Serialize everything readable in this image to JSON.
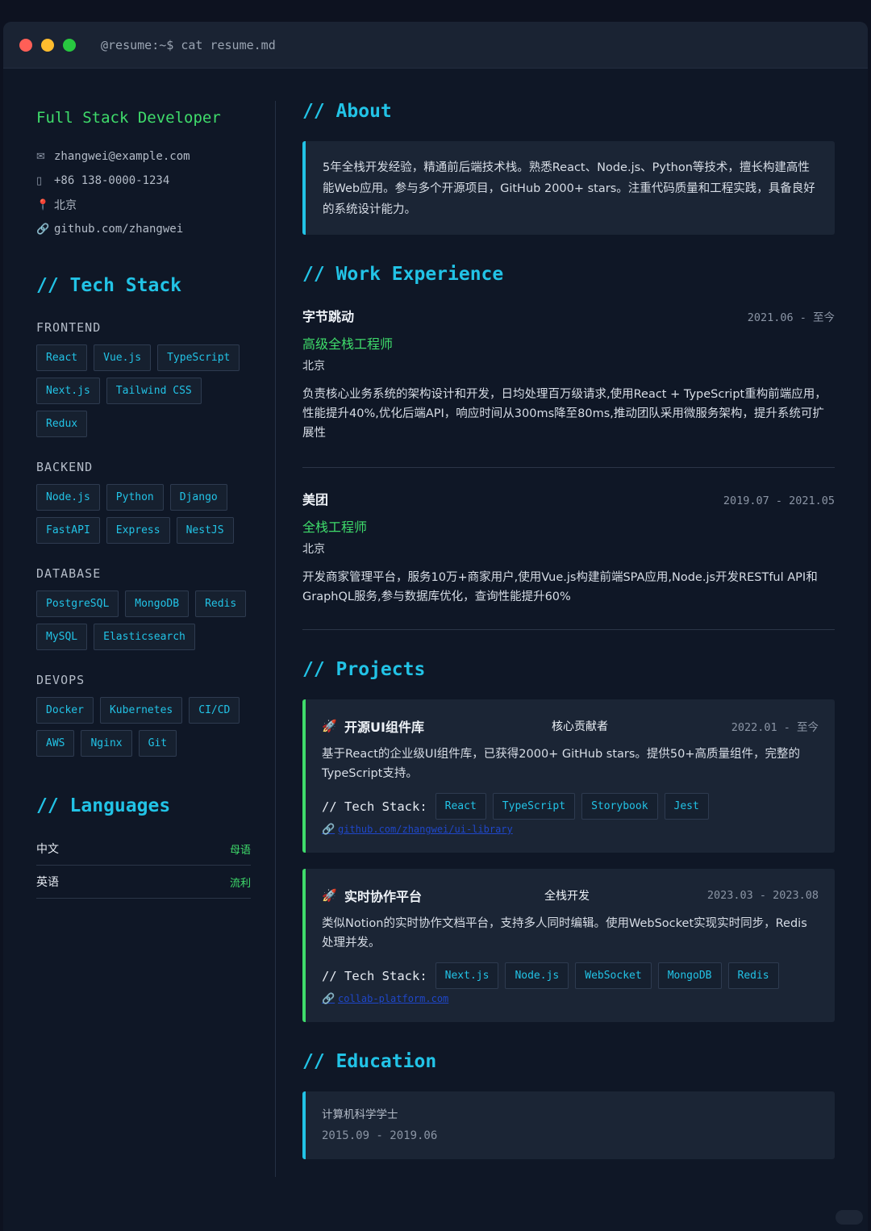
{
  "window": {
    "prompt": "@resume:~$ cat resume.md"
  },
  "sidebar": {
    "role": "Full Stack Developer",
    "contact": [
      {
        "icon": "email-icon",
        "glyph": "✉",
        "text": "zhangwei@example.com"
      },
      {
        "icon": "phone-icon",
        "glyph": "▯",
        "text": "+86 138-0000-1234"
      },
      {
        "icon": "location-pin-icon",
        "glyph": "📍",
        "text": "北京"
      },
      {
        "icon": "link-icon",
        "glyph": "🔗",
        "text": "github.com/zhangwei"
      }
    ],
    "tech_title": "// Tech Stack",
    "categories": [
      {
        "name": "FRONTEND",
        "tags": [
          "React",
          "Vue.js",
          "TypeScript",
          "Next.js",
          "Tailwind CSS",
          "Redux"
        ]
      },
      {
        "name": "BACKEND",
        "tags": [
          "Node.js",
          "Python",
          "Django",
          "FastAPI",
          "Express",
          "NestJS"
        ]
      },
      {
        "name": "DATABASE",
        "tags": [
          "PostgreSQL",
          "MongoDB",
          "Redis",
          "MySQL",
          "Elasticsearch"
        ]
      },
      {
        "name": "DEVOPS",
        "tags": [
          "Docker",
          "Kubernetes",
          "CI/CD",
          "AWS",
          "Nginx",
          "Git"
        ]
      }
    ],
    "lang_title": "// Languages",
    "languages": [
      {
        "name": "中文",
        "level": "母语"
      },
      {
        "name": "英语",
        "level": "流利"
      }
    ]
  },
  "about": {
    "title": "// About",
    "text": "5年全栈开发经验，精通前后端技术栈。熟悉React、Node.js、Python等技术，擅长构建高性能Web应用。参与多个开源项目，GitHub 2000+ stars。注重代码质量和工程实践，具备良好的系统设计能力。"
  },
  "work": {
    "title": "// Work Experience",
    "jobs": [
      {
        "company": "字节跳动",
        "period": "2021.06 - 至今",
        "title": "高级全栈工程师",
        "location": "北京",
        "desc": "负责核心业务系统的架构设计和开发，日均处理百万级请求,使用React + TypeScript重构前端应用，性能提升40%,优化后端API，响应时间从300ms降至80ms,推动团队采用微服务架构，提升系统可扩展性"
      },
      {
        "company": "美团",
        "period": "2019.07 - 2021.05",
        "title": "全栈工程师",
        "location": "北京",
        "desc": "开发商家管理平台，服务10万+商家用户,使用Vue.js构建前端SPA应用,Node.js开发RESTful API和GraphQL服务,参与数据库优化，查询性能提升60%"
      }
    ]
  },
  "projects": {
    "title": "// Projects",
    "stack_label": "// Tech Stack:",
    "items": [
      {
        "name": "开源UI组件库",
        "role": "核心贡献者",
        "period": "2022.01 - 至今",
        "desc": "基于React的企业级UI组件库，已获得2000+ GitHub stars。提供50+高质量组件，完整的TypeScript支持。",
        "stack": [
          "React",
          "TypeScript",
          "Storybook",
          "Jest"
        ],
        "link": "github.com/zhangwei/ui-library"
      },
      {
        "name": "实时协作平台",
        "role": "全栈开发",
        "period": "2023.03 - 2023.08",
        "desc": "类似Notion的实时协作文档平台，支持多人同时编辑。使用WebSocket实现实时同步，Redis处理并发。",
        "stack": [
          "Next.js",
          "Node.js",
          "WebSocket",
          "MongoDB",
          "Redis"
        ],
        "link": "collab-platform.com"
      }
    ]
  },
  "education": {
    "title": "// Education",
    "degree": "计算机科学学士",
    "period": "2015.09 - 2019.06"
  },
  "colors": {
    "accent": "#22c3e6",
    "green": "#3fdc6b",
    "bg": "#0f1726",
    "card": "#1b2535"
  }
}
